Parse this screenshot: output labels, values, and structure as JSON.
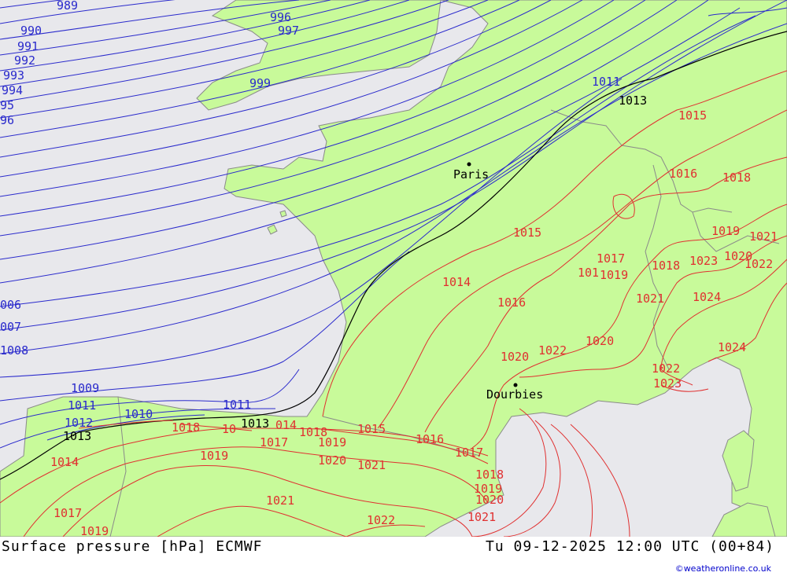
{
  "footer": {
    "product": "Surface pressure [hPa] ECMWF",
    "valid_time": "Tu 09-12-2025 12:00 UTC (00+84)",
    "credit": "©weatheronline.co.uk"
  },
  "colors": {
    "sea": "#e8e8ec",
    "land": "#c8fa9a",
    "coast": "#8a8a8a",
    "isobar_low": "#2a2acc",
    "isobar_ref": "#000000",
    "isobar_high": "#e03030"
  },
  "cities": [
    {
      "name": "Paris"
    },
    {
      "name": "Dourbies"
    }
  ],
  "isobar_labels_blue": [
    "989",
    "990",
    "991",
    "992",
    "993",
    "994",
    "95",
    "96",
    "996",
    "997",
    "999",
    "006",
    "007",
    "1008",
    "1009",
    "1011",
    "1012",
    "1010",
    "1011",
    "1011"
  ],
  "isobar_labels_black": [
    "1013",
    "1013",
    "1013"
  ],
  "isobar_labels_red": [
    "1015",
    "1016",
    "1018",
    "1019",
    "1021",
    "1015",
    "1017",
    "1019",
    "1018",
    "1023",
    "1020",
    "1022",
    "1014",
    "1016",
    "101",
    "1021",
    "1024",
    "1020",
    "1022",
    "1020",
    "1024",
    "1022",
    "1023",
    "1014",
    "1018",
    "10",
    "014",
    "1018",
    "1015",
    "1016",
    "1017",
    "1019",
    "1017",
    "1019",
    "1020",
    "1021",
    "1018",
    "1019",
    "1020",
    "1021",
    "1021",
    "1022",
    "1017",
    "1019"
  ]
}
